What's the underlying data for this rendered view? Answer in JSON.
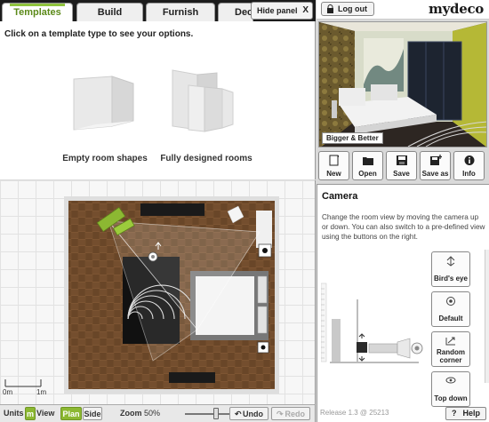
{
  "tabs": [
    {
      "label": "Templates"
    },
    {
      "label": "Build"
    },
    {
      "label": "Furnish"
    },
    {
      "label": "Dec"
    }
  ],
  "hide_panel": {
    "label": "Hide panel",
    "close": "X"
  },
  "templates": {
    "hint": "Click on a template type to see your options.",
    "items": [
      {
        "label": "Empty room shapes"
      },
      {
        "label": "Fully designed rooms"
      }
    ]
  },
  "header": {
    "logout_label": "Log out",
    "logo": "mydeco"
  },
  "preview": {
    "badge": "Bigger & Better"
  },
  "file_buttons": [
    {
      "label": "New",
      "icon": "new-file-icon"
    },
    {
      "label": "Open",
      "icon": "folder-icon"
    },
    {
      "label": "Save",
      "icon": "floppy-disk-icon"
    },
    {
      "label": "Save as",
      "icon": "floppy-plus-icon"
    },
    {
      "label": "Info",
      "icon": "info-icon"
    }
  ],
  "camera": {
    "title": "Camera",
    "description": "Change the room view by moving the camera up or down. You can also switch to a pre-defined view using the buttons on the right.",
    "buttons": [
      {
        "label": "Bird's eye",
        "icon": "birds-eye-icon"
      },
      {
        "label": "Default",
        "icon": "eye-icon"
      },
      {
        "label": "Random corner",
        "icon": "random-corner-icon"
      },
      {
        "label": "Top down",
        "icon": "top-down-icon"
      }
    ]
  },
  "scale": {
    "start": "0m",
    "end": "1m"
  },
  "toolbar": {
    "units_label": "Units",
    "unit_m": "m",
    "unit_view_suffix": "View",
    "plan_label": "Plan",
    "side_label": "Side",
    "zoom_label": "Zoom",
    "zoom_value": "50%",
    "undo_label": "Undo",
    "redo_label": "Redo"
  },
  "footer": {
    "release": "Release 1.3 @ 25213",
    "help_label": "Help",
    "help_icon": "?"
  },
  "colors": {
    "accent_green": "#8cb832",
    "tab_active_text": "#5c8a1a"
  }
}
